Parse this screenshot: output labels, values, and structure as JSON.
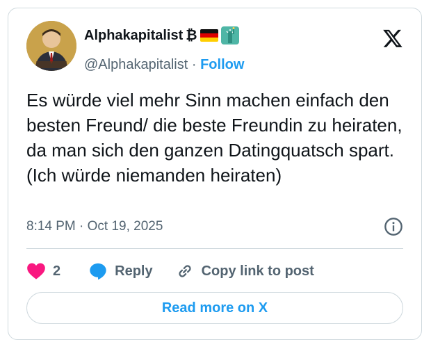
{
  "author": {
    "name": "Alphakapitalist",
    "name_suffix": "₿",
    "handle": "@Alphakapitalist",
    "separator": "·",
    "follow_label": "Follow"
  },
  "tweet": {
    "text": "Es würde viel mehr Sinn machen einfach den besten Freund/ die beste Freundin zu heiraten, da man sich den ganzen Datingquatsch spart. (Ich würde niemanden heiraten)",
    "timestamp": "8:14 PM · Oct 19, 2025"
  },
  "actions": {
    "like_count": "2",
    "reply_label": "Reply",
    "copy_label": "Copy link to post"
  },
  "read_more_label": "Read more on X",
  "colors": {
    "accent": "#1d9bf0",
    "heart": "#f91880",
    "muted": "#536471",
    "border": "#cfd9de"
  },
  "icons": [
    "x-logo-icon",
    "info-icon",
    "heart-icon",
    "reply-bubble-icon",
    "link-icon",
    "german-flag-icon",
    "statue-of-liberty-icon"
  ]
}
